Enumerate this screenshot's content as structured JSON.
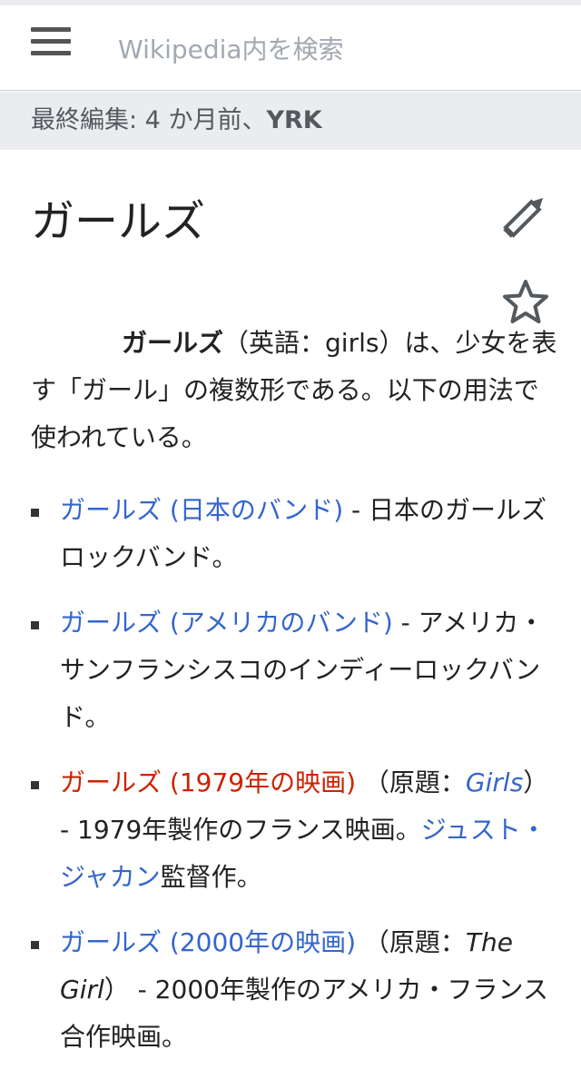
{
  "header": {
    "search_placeholder": "Wikipedia内を検索"
  },
  "last_edited": {
    "prefix": "最終編集: 4 か月前、",
    "user": "YRK"
  },
  "article": {
    "title": "ガールズ",
    "intro": {
      "bold": "ガールズ",
      "rest": "（英語：girls）は、少女を表す「ガール」の複数形である。以下の用法で使われている。"
    },
    "items": [
      {
        "link": "ガールズ (日本のバンド)",
        "desc": " - 日本のガールズロックバンド。"
      },
      {
        "link": "ガールズ (アメリカのバンド)",
        "desc": " - アメリカ・サンフランシスコのインディーロックバンド。"
      },
      {
        "link": "ガールズ (1979年の映画)",
        "orig_prefix": " （原題：",
        "orig_title": "Girls",
        "orig_suffix": "） - 1979年製作のフランス映画。",
        "director_link": "ジュスト・ジャカン",
        "tail": "監督作。"
      },
      {
        "link": "ガールズ (2000年の映画)",
        "orig_prefix": " （原題：",
        "orig_title": "The Girl",
        "orig_suffix": "） - 2000年製作のアメリカ・フランス合作映画。"
      }
    ]
  },
  "colors": {
    "link": "#3366cc",
    "redlink": "#cc2200",
    "bar": "#eaecf0"
  },
  "icons": [
    "menu-icon",
    "pencil-icon",
    "star-icon"
  ]
}
